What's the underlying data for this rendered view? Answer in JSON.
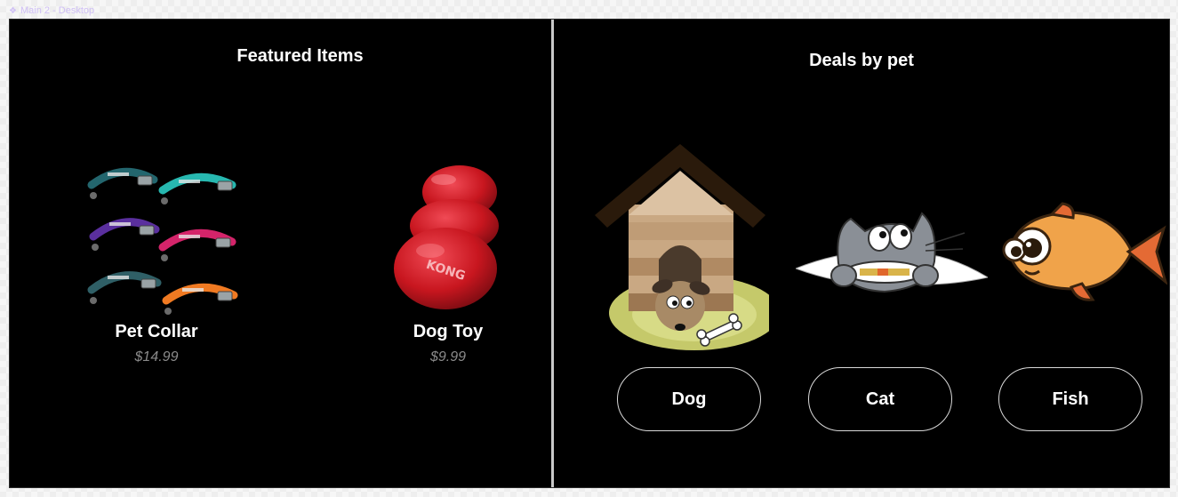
{
  "frame": {
    "label": "Main 2 - Desktop"
  },
  "featured": {
    "title": "Featured Items",
    "items": [
      {
        "name": "Pet Collar",
        "price": "$14.99",
        "image": "collar-set"
      },
      {
        "name": "Dog Toy",
        "price": "$9.99",
        "image": "kong-toy"
      }
    ]
  },
  "toy_brand": "KONG",
  "deals": {
    "title": "Deals by pet",
    "pets": [
      {
        "label": "Dog",
        "image": "dog-in-doghouse"
      },
      {
        "label": "Cat",
        "image": "cat-cartoon"
      },
      {
        "label": "Fish",
        "image": "fish-cartoon"
      }
    ]
  },
  "colors": {
    "background": "#000000",
    "text": "#ffffff",
    "price": "#8a8a8a",
    "button_border": "#d9d9d9",
    "divider": "#c9c9c9"
  }
}
